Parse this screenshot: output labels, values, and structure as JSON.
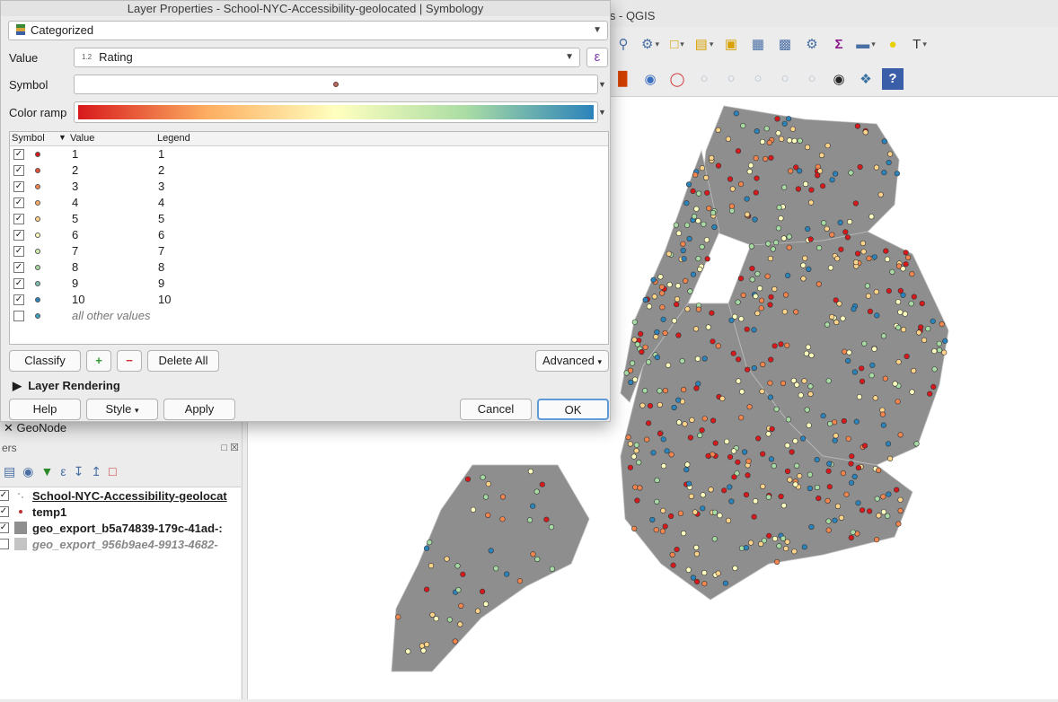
{
  "main_window": {
    "title": "is - QGIS"
  },
  "dialog": {
    "title": "Layer Properties - School-NYC-Accessibility-geolocated | Symbology",
    "renderer": "Categorized",
    "value_label": "Value",
    "value_type": "1.2",
    "value_field": "Rating",
    "symbol_label": "Symbol",
    "color_ramp_label": "Color ramp",
    "table_headers": {
      "symbol": "Symbol",
      "value": "Value",
      "legend": "Legend"
    },
    "classes": [
      {
        "value": "1",
        "legend": "1",
        "checked": true,
        "color": "#d7191c"
      },
      {
        "value": "2",
        "legend": "2",
        "checked": true,
        "color": "#e54f35"
      },
      {
        "value": "3",
        "legend": "3",
        "checked": true,
        "color": "#f3854e"
      },
      {
        "value": "4",
        "legend": "4",
        "checked": true,
        "color": "#fcac63"
      },
      {
        "value": "5",
        "legend": "5",
        "checked": true,
        "color": "#fed38a"
      },
      {
        "value": "6",
        "legend": "6",
        "checked": true,
        "color": "#ffffbf"
      },
      {
        "value": "7",
        "legend": "7",
        "checked": true,
        "color": "#d4edb1"
      },
      {
        "value": "8",
        "legend": "8",
        "checked": true,
        "color": "#a8dba4"
      },
      {
        "value": "9",
        "legend": "9",
        "checked": true,
        "color": "#7bbfaf"
      },
      {
        "value": "10",
        "legend": "10",
        "checked": true,
        "color": "#2b83ba"
      }
    ],
    "other_values": {
      "label": "all other values",
      "checked": false,
      "color": "#3a9fbf"
    },
    "buttons": {
      "classify": "Classify",
      "add": "+",
      "remove": "−",
      "delete_all": "Delete All",
      "advanced": "Advanced",
      "layer_rendering": "Layer Rendering",
      "help": "Help",
      "style": "Style",
      "apply": "Apply",
      "cancel": "Cancel",
      "ok": "OK"
    }
  },
  "browser_panel": {
    "geonode_label": "GeoNode"
  },
  "layers_panel": {
    "title": "ers",
    "layers": [
      {
        "name": "School-NYC-Accessibility-geolocat",
        "checked": true,
        "symbol": "dots"
      },
      {
        "name": "temp1",
        "checked": true,
        "symbol": "red-dot"
      },
      {
        "name": "geo_export_b5a74839-179c-41ad-:",
        "checked": true,
        "symbol": "gray-fill"
      },
      {
        "name": "geo_export_956b9ae4-9913-4682-",
        "checked": false,
        "symbol": "light-gray-fill"
      }
    ]
  },
  "map": {
    "background_color": "#ffffff",
    "land_color": "#8e8e8e",
    "point_colors": [
      "#d7191c",
      "#f3854e",
      "#fed38a",
      "#ffffbf",
      "#a8dba4",
      "#2b83ba"
    ]
  }
}
